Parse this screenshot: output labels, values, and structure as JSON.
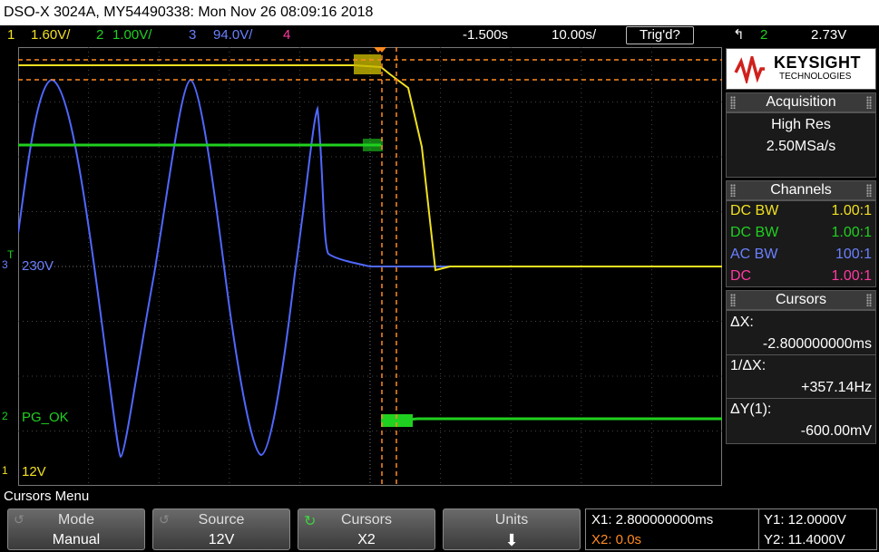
{
  "title": "DSO-X 3024A, MY54490338: Mon Nov 26 08:09:16 2018",
  "status": {
    "ch1_num": "1",
    "ch1_scale": "1.60V/",
    "ch2_num": "2",
    "ch2_scale": "1.00V/",
    "ch3_num": "3",
    "ch3_scale": "94.0V/",
    "ch4_num": "4",
    "delay": "-1.500s",
    "timebase": "10.00s/",
    "trigger_state": "Trig'd?",
    "trigger_slope": "↰",
    "trigger_source": "2",
    "trigger_level": "2.73V"
  },
  "brand": {
    "name": "KEYSIGHT",
    "sub": "TECHNOLOGIES",
    "color": "#d0201c"
  },
  "acquisition": {
    "header": "Acquisition",
    "mode": "High Res",
    "rate": "2.50MSa/s"
  },
  "channels": {
    "header": "Channels",
    "rows": [
      {
        "coupling": "DC BW",
        "probe": "1.00:1",
        "color": "#f0e020"
      },
      {
        "coupling": "DC BW",
        "probe": "1.00:1",
        "color": "#20d020"
      },
      {
        "coupling": "AC BW",
        "probe": "100:1",
        "color": "#6a80ff"
      },
      {
        "coupling": "DC",
        "probe": "1.00:1",
        "color": "#ff3aa0"
      }
    ]
  },
  "cursors": {
    "header": "Cursors",
    "dx_label": "ΔX:",
    "dx_value": "-2.800000000ms",
    "inv_label": "1/ΔX:",
    "inv_value": "+357.14Hz",
    "dy_label": "ΔY(1):",
    "dy_value": "-600.00mV"
  },
  "trace_labels": {
    "ch3_marker": "3",
    "ch3_label": "230V",
    "ch2_marker": "2",
    "ch2_label": "PG_OK",
    "ch1_marker": "1",
    "ch1_label": "12V",
    "trig_marker": "T"
  },
  "menu": {
    "title": "Cursors Menu",
    "softkeys": [
      {
        "title": "Mode",
        "value": "Manual"
      },
      {
        "title": "Source",
        "value": "12V"
      },
      {
        "title": "Cursors",
        "value": "X2"
      },
      {
        "title": "Units",
        "value": "⬇"
      }
    ]
  },
  "readout": {
    "x1": "X1: 2.800000000ms",
    "x2": "X2: 0.0s",
    "y1": "Y1: 12.0000V",
    "y2": "Y2: 11.4000V"
  },
  "colors": {
    "ch1": "#f0e020",
    "ch2": "#20d020",
    "ch3": "#5068ff",
    "ch4": "#ff3aa0",
    "cursor": "#ff8a20"
  }
}
